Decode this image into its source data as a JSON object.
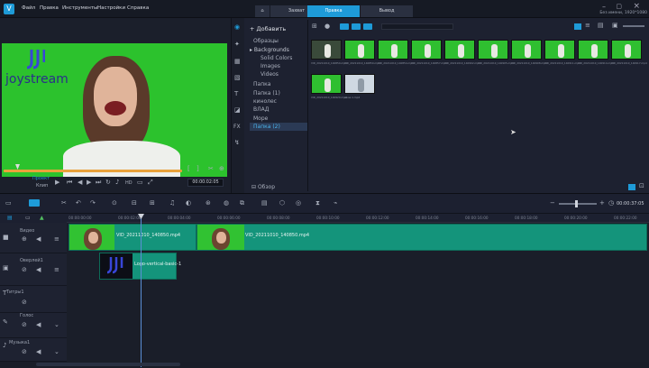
{
  "menu": {
    "items": [
      "Файл",
      "Правка",
      "Инструменты",
      "Настройки",
      "Справка"
    ]
  },
  "tabs": {
    "items": [
      "Захват",
      "Правка",
      "Вывод"
    ],
    "active": 1
  },
  "window": {
    "status": "Без имени, 1920*1080"
  },
  "preview": {
    "watermark": "joystream",
    "mode_project": "Проект",
    "mode_clip": "Клип",
    "timecode": "00:00:02:05",
    "hd_label": "HD"
  },
  "library": {
    "add_label": "Добавить",
    "folders": [
      "Образцы",
      "Backgrounds",
      "Solid Colors",
      "Images",
      "Videos",
      "Папка",
      "Папка (1)",
      "кинолес",
      "ВЛАД",
      "Море",
      "Папка (2)"
    ],
    "selected_folder": "Папка (2)",
    "browse_label": "Обзор",
    "thumbs": [
      {
        "label": "VID_20211010_140850.mp4",
        "kind": "video"
      },
      {
        "label": "VID_20211010_140850.mp4",
        "kind": "green"
      },
      {
        "label": "VID_20211010_140854.mp4",
        "kind": "green"
      },
      {
        "label": "VID_20211010_140857.mp4",
        "kind": "green"
      },
      {
        "label": "VID_20211010_140902.mp4",
        "kind": "green"
      },
      {
        "label": "VID_20211010_140905.mp4",
        "kind": "green"
      },
      {
        "label": "VID_20211010_140908.mp4",
        "kind": "green"
      },
      {
        "label": "VID_20211010_140911.mp4",
        "kind": "green"
      },
      {
        "label": "VID_20211010_140914.mp4",
        "kind": "green"
      },
      {
        "label": "VID_20211010_140917.mp4",
        "kind": "green"
      },
      {
        "label": "VID_20211010_140920.mp4",
        "kind": "green"
      },
      {
        "label": "snow-1.mp4",
        "kind": "snow"
      }
    ]
  },
  "timeline": {
    "timecode": "00:00:37:05",
    "ruler": [
      "00:00:00:00",
      "00:00:02:00",
      "00:00:04:00",
      "00:00:06:00",
      "00:00:08:00",
      "00:00:10:00",
      "00:00:12:00",
      "00:00:14:00",
      "00:00:16:00",
      "00:00:18:00",
      "00:00:20:00",
      "00:00:22:00"
    ],
    "tracks": [
      {
        "name": "Видео"
      },
      {
        "name": "Оверлей1"
      },
      {
        "name": "Титры1"
      },
      {
        "name": "Голос"
      },
      {
        "name": "Музыка1"
      }
    ],
    "clips": {
      "video1": "VID_20211010_140850.mp4",
      "video2": "VID_20211010_140850.mp4",
      "overlay": "Logo-vertical-basic-1"
    }
  }
}
